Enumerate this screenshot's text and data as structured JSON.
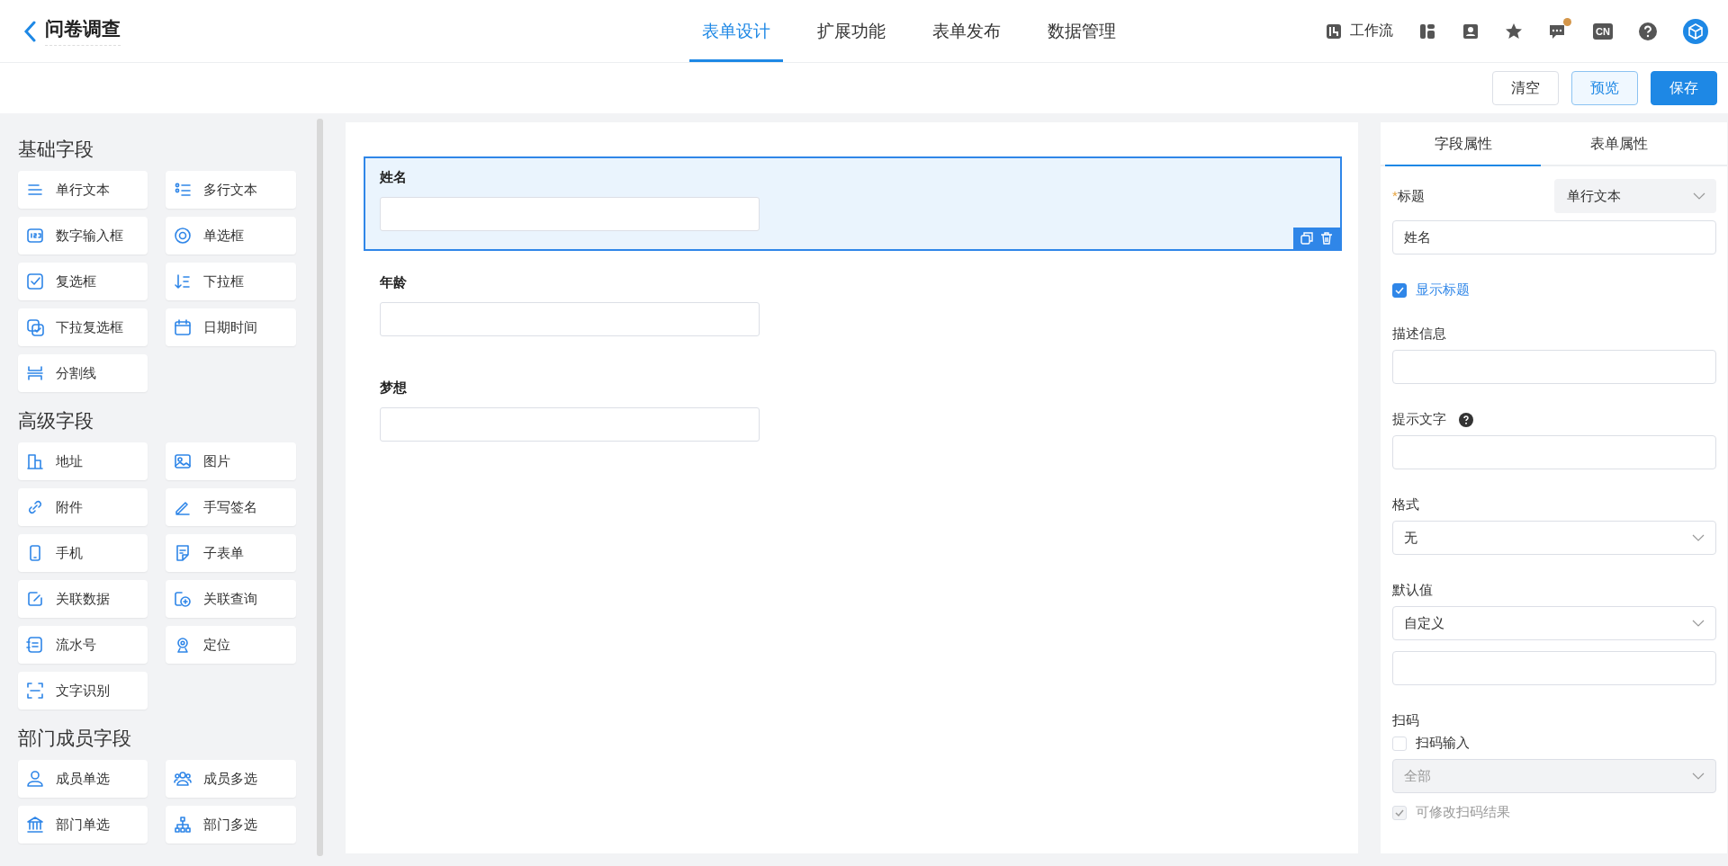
{
  "header": {
    "title": "问卷调查",
    "nav": [
      {
        "label": "表单设计",
        "selected": true
      },
      {
        "label": "扩展功能",
        "selected": false
      },
      {
        "label": "表单发布",
        "selected": false
      },
      {
        "label": "数据管理",
        "selected": false
      }
    ],
    "workflow": "工作流",
    "language": "CN",
    "messages_unread": true
  },
  "toolbar": [
    {
      "label": "清空",
      "kind": "default"
    },
    {
      "label": "预览",
      "kind": "secondary"
    },
    {
      "label": "保存",
      "kind": "primary"
    }
  ],
  "palette": [
    {
      "title": "基础字段",
      "items": [
        "单行文本",
        "多行文本",
        "数字输入框",
        "单选框",
        "复选框",
        "下拉框",
        "下拉复选框",
        "日期时间",
        "分割线"
      ]
    },
    {
      "title": "高级字段",
      "items": [
        "地址",
        "图片",
        "附件",
        "手写签名",
        "手机",
        "子表单",
        "关联数据",
        "关联查询",
        "流水号",
        "定位",
        "文字识别"
      ]
    },
    {
      "title": "部门成员字段",
      "items": [
        "成员单选",
        "成员多选",
        "部门单选",
        "部门多选"
      ]
    }
  ],
  "canvas": {
    "fields": [
      {
        "label": "姓名",
        "selected": true
      },
      {
        "label": "年龄",
        "selected": false
      },
      {
        "label": "梦想",
        "selected": false
      }
    ]
  },
  "properties": {
    "tabs": [
      {
        "label": "字段属性",
        "selected": true
      },
      {
        "label": "表单属性",
        "selected": false
      }
    ],
    "required_mark": "*",
    "title_label": "标题",
    "field_type": "单行文本",
    "title_value": "姓名",
    "show_title": {
      "label": "显示标题",
      "checked": true
    },
    "description_label": "描述信息",
    "hint_label": "提示文字",
    "format": {
      "label": "格式",
      "value": "无"
    },
    "default": {
      "label": "默认值",
      "value": "自定义"
    },
    "scan": {
      "label": "扫码",
      "input": {
        "label": "扫码输入",
        "checked": false
      },
      "mode": {
        "value": "全部",
        "disabled": true
      },
      "editable": {
        "label": "可修改扫码结果",
        "checked": true,
        "disabled": true
      }
    }
  }
}
